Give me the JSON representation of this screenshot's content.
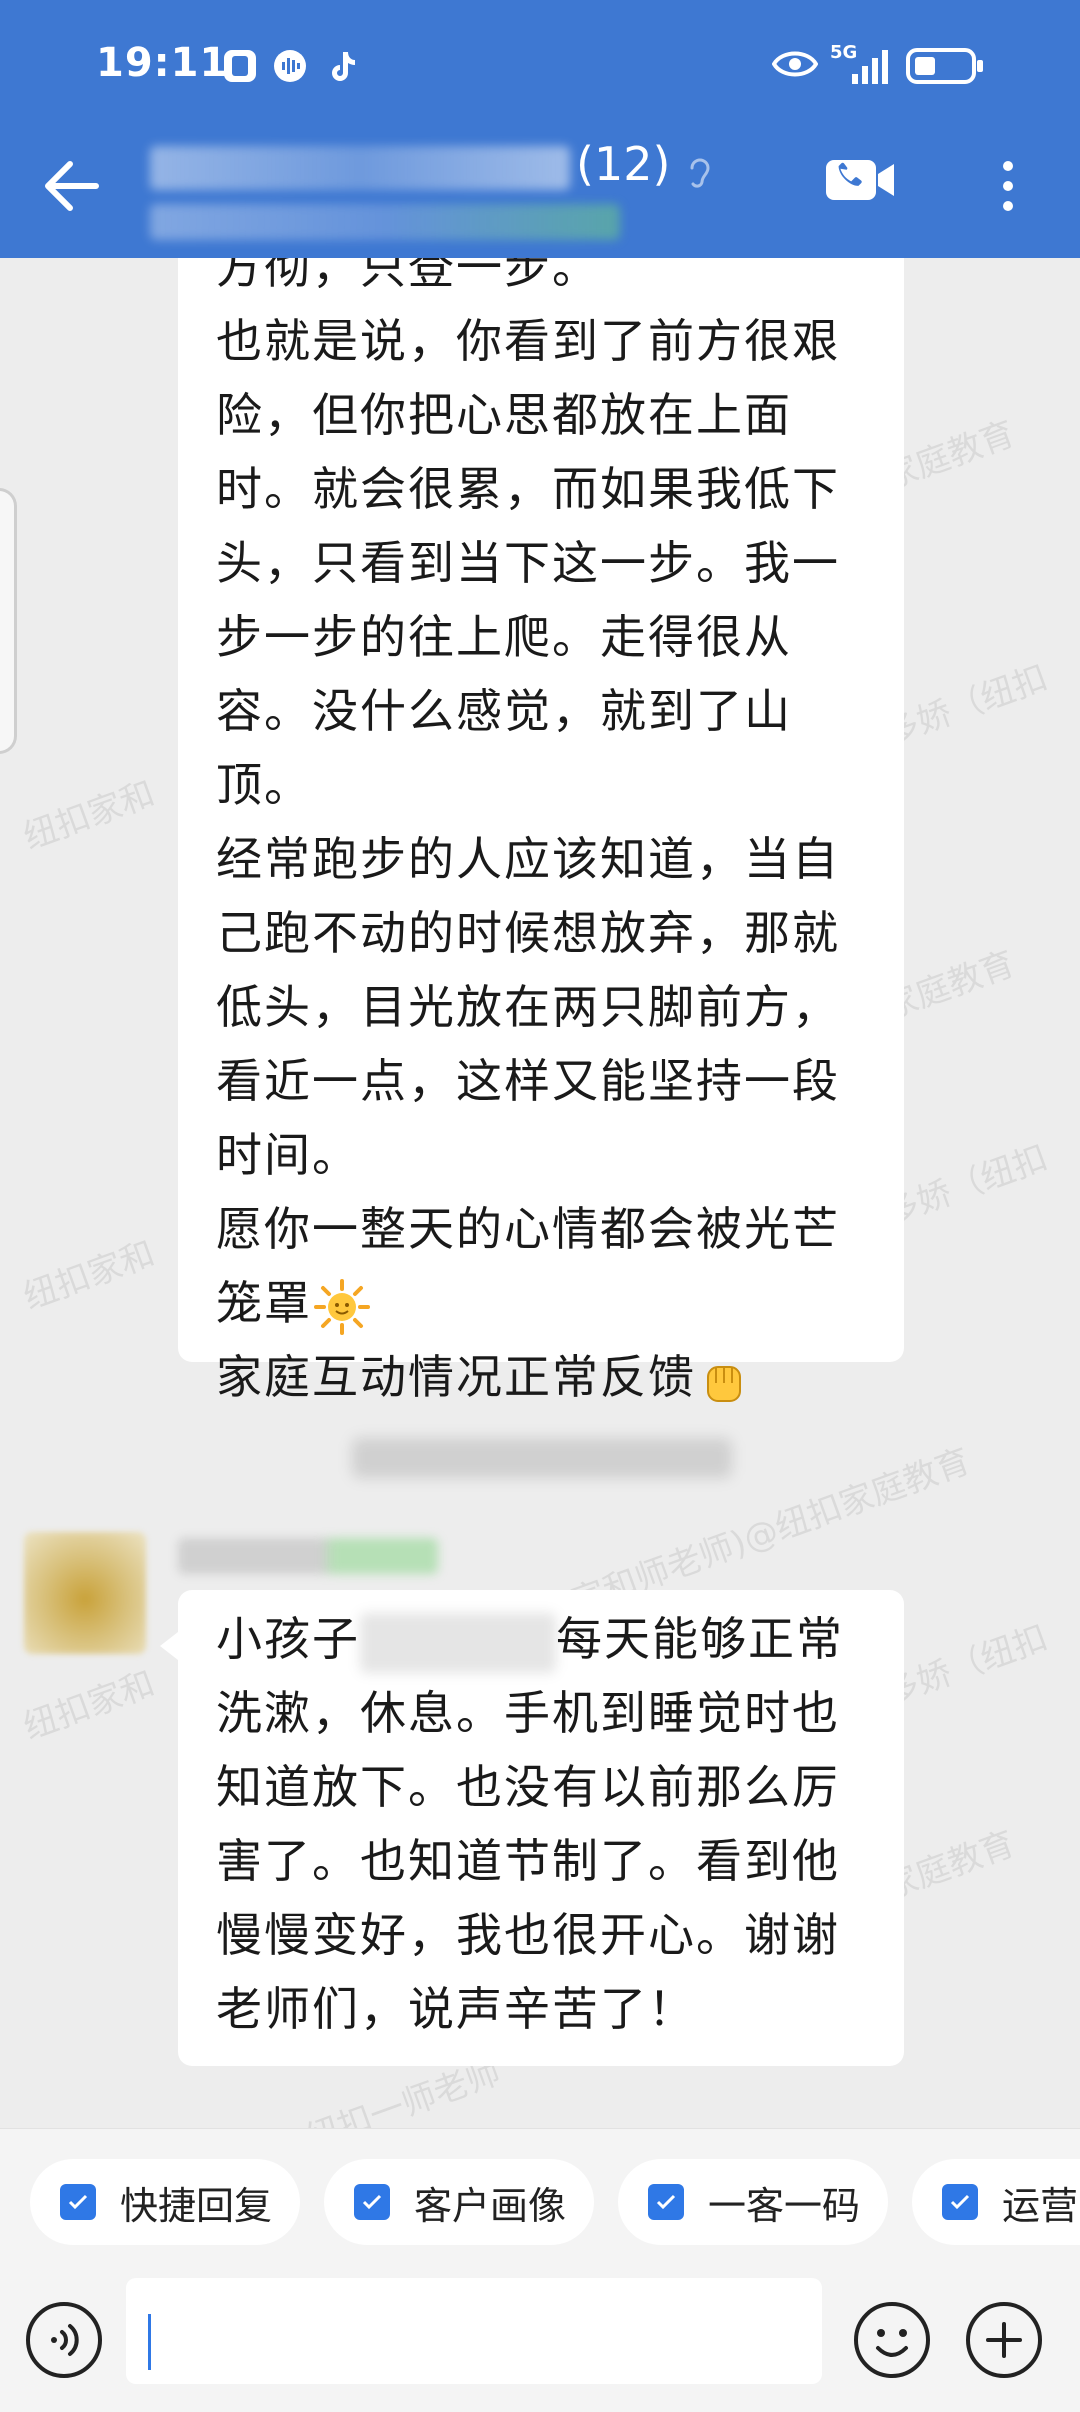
{
  "status_bar": {
    "time": "19:11",
    "network": "5G",
    "icons": [
      "notification-app-icon",
      "audio-app-icon",
      "tiktok-icon",
      "eye-icon",
      "signal-icon",
      "battery-icon"
    ]
  },
  "header": {
    "member_count": "(12)",
    "background_color": "#3e78d2"
  },
  "messages": {
    "bubble_1": {
      "lines": [
        "方彻，只登一步。",
        "也就是说，你看到了前方很艰险，但你把心思都放在上面时。就会很累，而如果我低下头，只看到当下这一步。我一步一步的往上爬。走得很从容。没什么感觉，就到了山顶。",
        "经常跑步的人应该知道，当自己跑不动的时候想放弃，那就低头，目光放在两只脚前方，看近一点，这样又能坚持一段时间。",
        "愿你一整天的心情都会被光芒笼罩",
        "家庭互动情况正常反馈"
      ]
    },
    "bubble_2": {
      "prefix": "小孩子",
      "text": "每天能够正常洗漱，休息。手机到睡觉时也知道放下。也没有以前那么厉害了。也知道节制了。看到他慢慢变好，我也很开心。谢谢老师们，说声辛苦了！"
    },
    "watermarks": [
      "家庭教育",
      "纽扣家和",
      "多娇（纽扣",
      "(纽扣家和师老师)@纽扣家庭教育",
      "纽扣一师老师"
    ]
  },
  "quick_bar": {
    "accent": "#2f78e6",
    "chips": [
      {
        "label": "快捷回复"
      },
      {
        "label": "客户画像"
      },
      {
        "label": "一客一码"
      },
      {
        "label": "运营"
      }
    ]
  },
  "input": {
    "value": ""
  }
}
